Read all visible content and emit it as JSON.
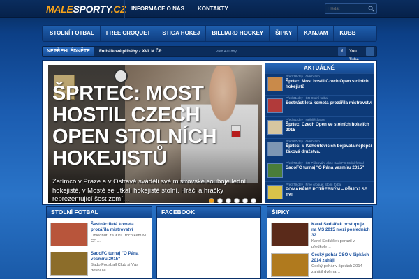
{
  "logo": {
    "part1": "MALE",
    "part2": "SPORTY",
    "part3": ".CZ"
  },
  "topnav": [
    {
      "label": "INFORMACE O NÁS"
    },
    {
      "label": "KONTAKTY"
    }
  ],
  "search": {
    "placeholder": "Hledat"
  },
  "categories": [
    {
      "label": "STOLNÍ FOTBAL"
    },
    {
      "label": "FREE CROQUET"
    },
    {
      "label": "STIGA HOKEJ"
    },
    {
      "label": "BILLIARD HOCKEY"
    },
    {
      "label": "ŠIPKY"
    },
    {
      "label": "KANJAM"
    },
    {
      "label": "KUBB"
    }
  ],
  "ticker": {
    "label": "NEPŘEHLÉDNĚTE",
    "text": "Fotbálkové příběhy z XVI. M ČR",
    "time": "Před 421 dny",
    "social_fb": "f",
    "social_yt": "You Tube"
  },
  "hero": {
    "headline": "ŠPRTEC: MOST HOSTIL CZECH OPEN STOLNÍCH HOKEJISTŮ",
    "excerpt": "Zatímco v Praze a v Ostravě sváděli své mistrovské souboje lední hokejisté, v Mostě se utkali hokejisté stolní. Hráči a hračky reprezentující šest zemí…",
    "slides": 6,
    "active_slide": 1
  },
  "aktualne": {
    "title": "AKTUÁLNĚ",
    "items": [
      {
        "meta": "Před 18 dny | Odehráno",
        "title": "Šprtec: Most hostil Czech Open stolních hokejistů",
        "color": "#c98a4a"
      },
      {
        "meta": "Před 31 dny | ČR Stolní fotbal",
        "title": "Šestnáctiletá kometa prozářila mistrovství",
        "color": "#b13a3a"
      },
      {
        "meta": "Před 51 dny | Nejbližší akce",
        "title": "Šprtec: Czech Open ve stolních hokejích 2015",
        "color": "#d7c6a0"
      },
      {
        "meta": "Před 67 dny | Odehráno",
        "title": "Šprtec: V Kohoutovicích bojovala nejlepší žáková družstva.",
        "color": "#7d96b3"
      },
      {
        "meta": "Před 73 dny | ČR Přiřcování akce SadoFC Stolní fotbal",
        "title": "SadoFC turnaj \"O Pána vesmíru 2015\"",
        "color": "#4a7d3a"
      },
      {
        "meta": "Před 79 dny | Free croquet Stolní fotbal",
        "title": "POMÁHÁME POTŘEBNÝM – PŘIJOJ SE I TY!",
        "color": "#d9c24a"
      }
    ]
  },
  "panels": {
    "stolni": {
      "title": "STOLNÍ FOTBAL",
      "items": [
        {
          "title": "Šestnáctiletá kometa prozářila mistrovství",
          "excerpt": "Ohlédnutí za XVII. ročníkem M ČR…",
          "color": "#b8553b"
        },
        {
          "title": "SadoFC turnaj \"O Pána vesmíru 2015\"",
          "excerpt": "Sado Foosball Club si Vás dovoluje…",
          "color": "#8c6d2a"
        }
      ]
    },
    "facebook": {
      "title": "FACEBOOK"
    },
    "sipky": {
      "title": "ŠIPKY",
      "items": [
        {
          "title": "Karel Sedláček postupuje na MS 2015 mezi posledních 32",
          "excerpt": "Karel Sedláček porazil v předkole…",
          "color": "#5a2a1a"
        },
        {
          "title": "Český pohár ČSO v šipkách 2014 zahájil",
          "excerpt": "Český pohár v šipkách 2014 zahájil dvěma…",
          "color": "#b07a1e"
        }
      ]
    }
  }
}
